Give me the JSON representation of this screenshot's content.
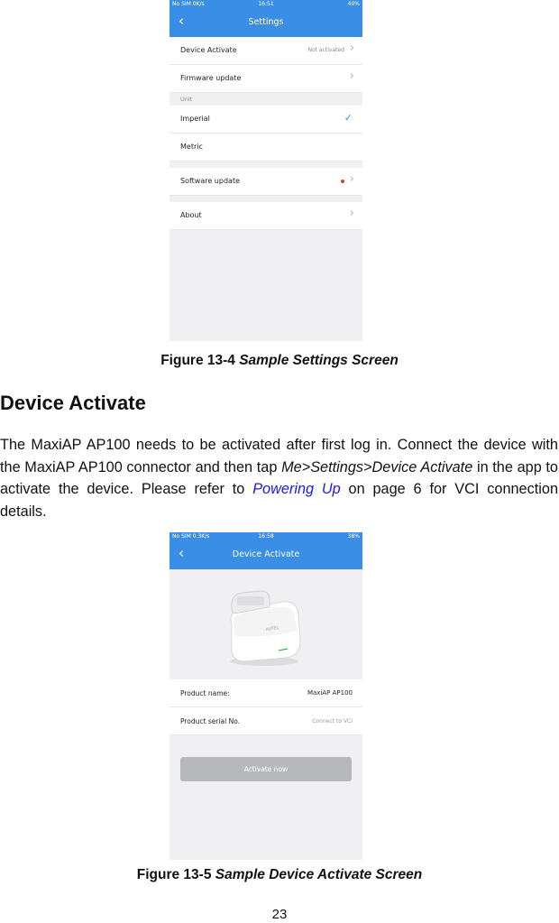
{
  "figure1": {
    "status": {
      "left": "No SIM 0K/s",
      "time": "16:51",
      "right": "40%"
    },
    "nav_title": "Settings",
    "rows": {
      "device_activate": {
        "label": "Device Activate",
        "value": "Not activated"
      },
      "firmware_update": {
        "label": "Firmware update"
      },
      "unit_header": "Unit",
      "imperial": {
        "label": "Imperial",
        "selected": true
      },
      "metric": {
        "label": "Metric"
      },
      "software_update": {
        "label": "Software update",
        "badge_color": "#e53935"
      },
      "about": {
        "label": "About"
      }
    },
    "caption_prefix": "Figure 13-4 ",
    "caption_title": "Sample Settings Screen"
  },
  "section": {
    "heading": "Device Activate",
    "para_1": "The MaxiAP AP100 needs to be activated after first log in. Connect the device with the MaxiAP AP100 connector and then tap ",
    "para_path": "Me>Settings>Device Activate",
    "para_2": " in the app to activate the device. Please refer to ",
    "para_link": "Powering Up",
    "para_3": " on page 6 for VCI connection details."
  },
  "figure2": {
    "status": {
      "left": "No SIM 0.3K/s",
      "time": "16:58",
      "right": "38%"
    },
    "nav_title": "Device Activate",
    "product_name_label": "Product name:",
    "product_name_value": "MaxiAP AP100",
    "serial_label": "Product serial No.",
    "serial_hint": "Connect to VCI",
    "activate_button": "Activate now",
    "caption_prefix": "Figure 13-5 ",
    "caption_title": "Sample Device Activate Screen"
  },
  "page_number": "23",
  "colors": {
    "accent": "#3a8ee6",
    "link": "#1a1ae6",
    "badge": "#e53935"
  }
}
